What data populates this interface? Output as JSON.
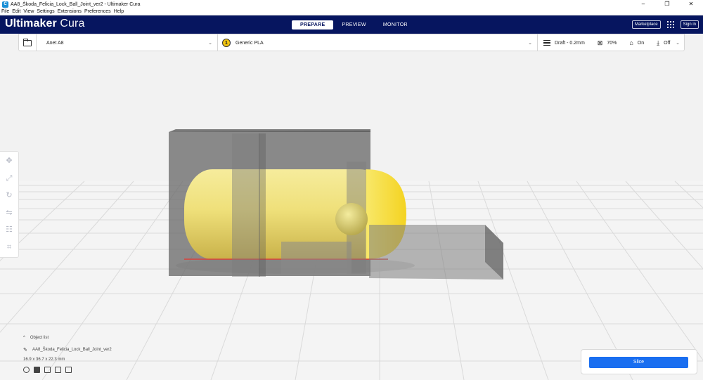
{
  "window": {
    "title": "AA8_Škoda_Felicia_Lock_Ball_Joint_ver2 - Ultimaker Cura",
    "controls": {
      "minimize": "–",
      "maximize": "❐",
      "close": "✕"
    }
  },
  "menu": [
    "File",
    "Edit",
    "View",
    "Settings",
    "Extensions",
    "Preferences",
    "Help"
  ],
  "header": {
    "brand_bold": "Ultimaker",
    "brand_light": "Cura",
    "tabs": [
      "PREPARE",
      "PREVIEW",
      "MONITOR"
    ],
    "active_tab": "PREPARE",
    "marketplace": "Marketplace",
    "sign_in": "Sign in"
  },
  "toolbar": {
    "printer": "Anet A8",
    "material": "Generic PLA",
    "material_spool_number": "1",
    "profile": "Draft - 0.2mm",
    "infill": "70%",
    "support": "On",
    "adhesion": "Off"
  },
  "tools": [
    "move-icon",
    "scale-icon",
    "rotate-icon",
    "mirror-icon",
    "per-model-settings-icon",
    "support-blocker-icon"
  ],
  "object_list": {
    "header": "Object list",
    "object_name": "AA8_Škoda_Felicia_Lock_Ball_Joint_ver2",
    "dimensions": "16.9 x 36.7 x 22.3 mm"
  },
  "slice": {
    "button_label": "Slice"
  },
  "colors": {
    "header_bg": "#06155f",
    "accent_blue": "#196ef0",
    "model_yellow": "#f3e27a",
    "support_gray": "#7a7a7a"
  }
}
